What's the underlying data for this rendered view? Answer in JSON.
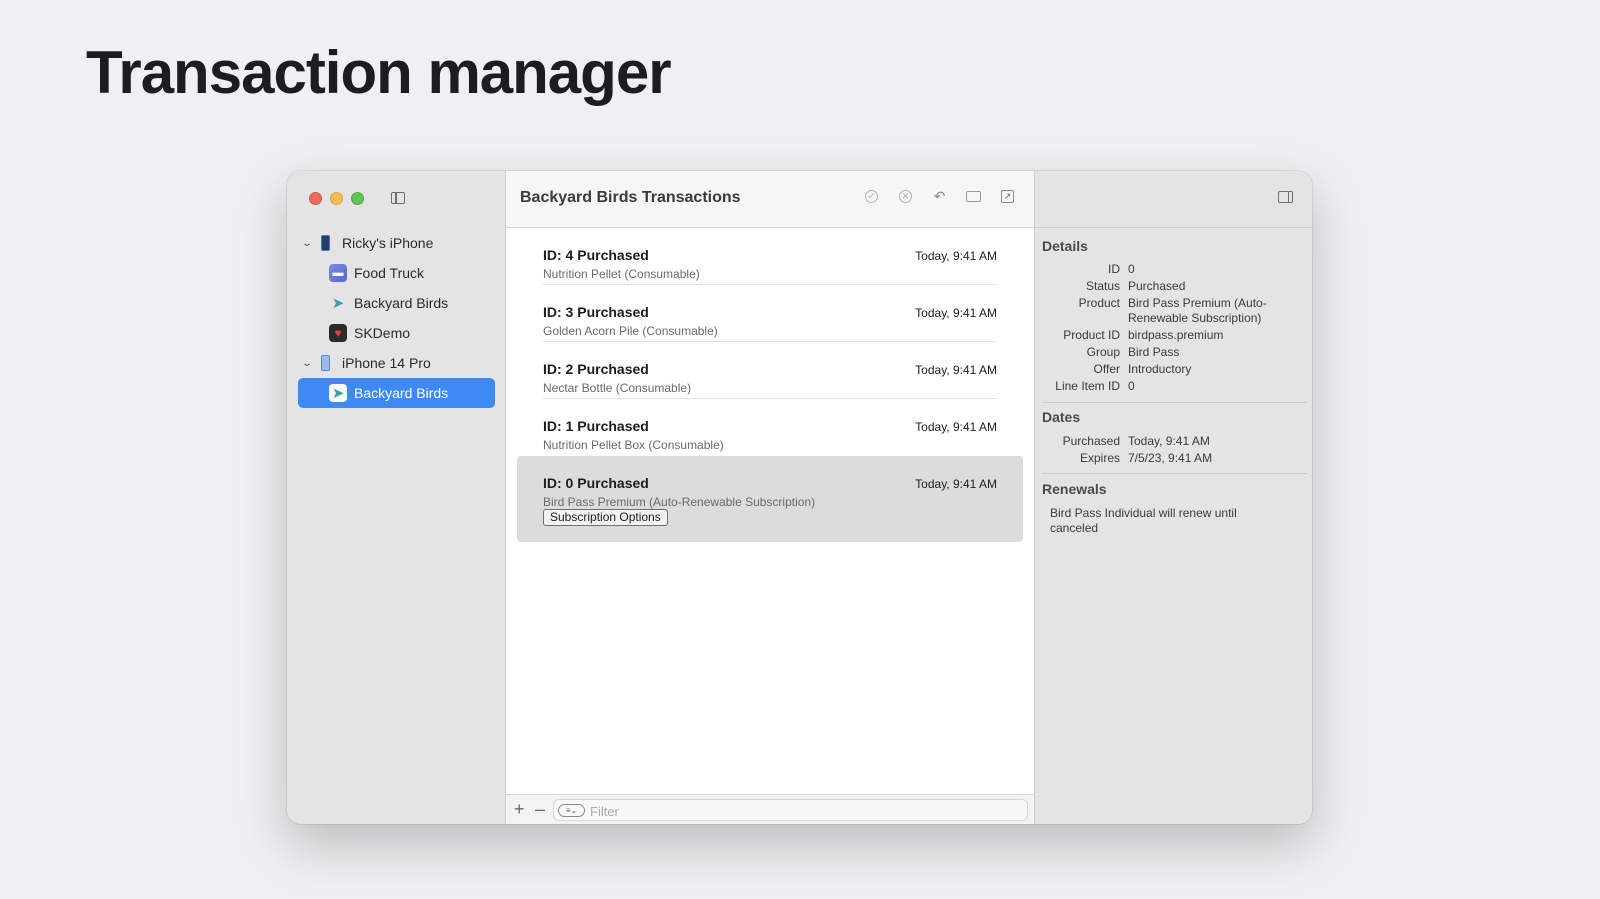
{
  "slide": {
    "title": "Transaction manager"
  },
  "sidebar": {
    "devices": [
      {
        "name": "Ricky's iPhone",
        "apps": [
          {
            "name": "Food Truck",
            "icon": "food-truck-icon"
          },
          {
            "name": "Backyard Birds",
            "icon": "bird-icon"
          },
          {
            "name": "SKDemo",
            "icon": "skdemo-icon"
          }
        ]
      },
      {
        "name": "iPhone 14 Pro",
        "apps": [
          {
            "name": "Backyard Birds",
            "icon": "bird-icon",
            "selected": true
          }
        ]
      }
    ]
  },
  "toolbar": {
    "title": "Backyard Birds Transactions",
    "icons": [
      "approve-icon",
      "decline-icon",
      "refund-icon",
      "billing-icon",
      "open-external-icon"
    ]
  },
  "transactions": [
    {
      "id_label": "ID: 4 Purchased",
      "product": "Nutrition Pellet (Consumable)",
      "time": "Today, 9:41 AM"
    },
    {
      "id_label": "ID: 3 Purchased",
      "product": "Golden Acorn Pile (Consumable)",
      "time": "Today, 9:41 AM"
    },
    {
      "id_label": "ID: 2 Purchased",
      "product": "Nectar Bottle (Consumable)",
      "time": "Today, 9:41 AM"
    },
    {
      "id_label": "ID: 1 Purchased",
      "product": "Nutrition Pellet Box (Consumable)",
      "time": "Today, 9:41 AM"
    },
    {
      "id_label": "ID: 0 Purchased",
      "product": "Bird Pass Premium (Auto-Renewable Subscription)",
      "time": "Today, 9:41 AM",
      "button": "Subscription Options"
    }
  ],
  "bottombar": {
    "plus": "+",
    "minus": "–",
    "filter_placeholder": "Filter"
  },
  "inspector": {
    "details_title": "Details",
    "details": [
      {
        "key": "ID",
        "value": "0"
      },
      {
        "key": "Status",
        "value": "Purchased"
      },
      {
        "key": "Product",
        "value": "Bird Pass Premium (Auto-Renewable Subscription)"
      },
      {
        "key": "Product ID",
        "value": "birdpass.premium"
      },
      {
        "key": "Group",
        "value": "Bird Pass"
      },
      {
        "key": "Offer",
        "value": "Introductory"
      },
      {
        "key": "Line Item ID",
        "value": "0"
      }
    ],
    "dates_title": "Dates",
    "dates": [
      {
        "key": "Purchased",
        "value": "Today, 9:41 AM"
      },
      {
        "key": "Expires",
        "value": "7/5/23, 9:41 AM"
      }
    ],
    "renewals_title": "Renewals",
    "renewals_text": "Bird Pass Individual will renew until canceled"
  }
}
